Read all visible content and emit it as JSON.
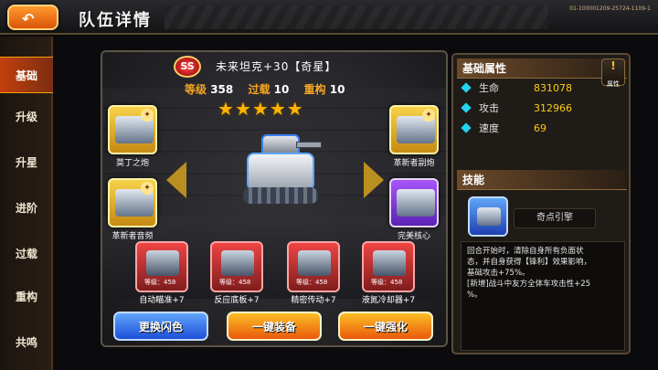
{
  "header": {
    "back_icon": "back-arrow-icon",
    "title": "队伍详情",
    "session_id": "01-100001209-25724-1109-1"
  },
  "sidebar": {
    "items": [
      {
        "label": "基础",
        "active": true
      },
      {
        "label": "升级",
        "active": false
      },
      {
        "label": "升星",
        "active": false
      },
      {
        "label": "进阶",
        "active": false
      },
      {
        "label": "过载",
        "active": false
      },
      {
        "label": "重构",
        "active": false
      },
      {
        "label": "共鸣",
        "active": false
      }
    ]
  },
  "unit": {
    "rank": "SS",
    "name": "未来坦克+30【奇星】",
    "stats": [
      {
        "label": "等级",
        "value": "358"
      },
      {
        "label": "过载",
        "value": "10"
      },
      {
        "label": "重构",
        "value": "10"
      }
    ],
    "stars": 5
  },
  "equipment": [
    {
      "name": "莫丁之炮",
      "rarity": "gold"
    },
    {
      "name": "革新者副炮",
      "rarity": "gold"
    },
    {
      "name": "革新者音频",
      "rarity": "gold"
    },
    {
      "name": "完美核心",
      "rarity": "purple"
    }
  ],
  "chips": [
    {
      "name": "自动瞄准+7",
      "level_label": "等级：458",
      "color": "red"
    },
    {
      "name": "反应底板+7",
      "level_label": "等级：458",
      "color": "red"
    },
    {
      "name": "精密传动+7",
      "level_label": "等级：458",
      "color": "red"
    },
    {
      "name": "液氮冷却器+7",
      "level_label": "等级：458",
      "color": "red"
    }
  ],
  "actions": {
    "change_color": "更换闪色",
    "equip_all": "一键装备",
    "enhance_all": "一键强化"
  },
  "attributes": {
    "heading": "基础属性",
    "button_label": "属性",
    "rows": [
      {
        "label": "生命",
        "value": "831078"
      },
      {
        "label": "攻击",
        "value": "312966"
      },
      {
        "label": "速度",
        "value": "69"
      }
    ]
  },
  "skill": {
    "heading": "技能",
    "name": "奇点引擎",
    "description_lines": [
      "回合开始时，清除自身所有负面状",
      "态，并自身获得【锋利】效果影响，",
      "基础攻击+75%。",
      "[新增]战斗中友方全体车攻击性+25",
      "%。"
    ]
  },
  "colors": {
    "accent": "#f5a623",
    "active_nav": "#c2410c",
    "value_yellow": "#facc15"
  }
}
